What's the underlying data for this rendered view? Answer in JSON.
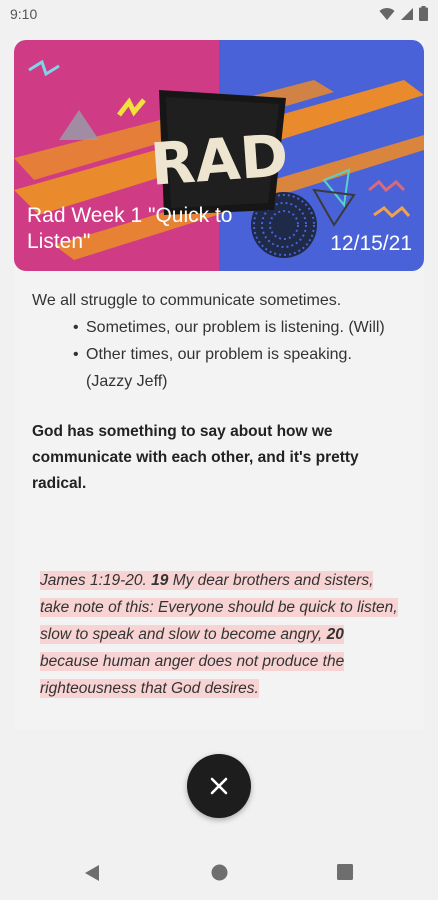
{
  "status_bar": {
    "time": "9:10"
  },
  "banner": {
    "logo_text": "RAD",
    "title": "Rad Week 1 \"Quick to Listen\"",
    "date": "12/15/21"
  },
  "content": {
    "intro": "We all struggle to communicate sometimes.",
    "bullets": [
      "Sometimes, our problem is listening. (Will)",
      "Other times, our problem is speaking. (Jazzy Jeff)"
    ],
    "bold_paragraph": "God has something to say about how we communicate with each other, and it's pretty radical.",
    "quote": {
      "reference": "James 1:19-20.",
      "verse1_num": "19",
      "verse1_text": "My dear brothers and sisters, take note of this: Everyone should be quick to listen, slow to speak and slow to become angry,",
      "verse2_num": "20",
      "verse2_text": "because human anger does not produce the righteousness that God desires."
    }
  },
  "colors": {
    "highlight": "#f7d3d3",
    "fab": "#1d1d1d",
    "banner_pink": "#cf3c85",
    "banner_blue": "#4a62d8"
  }
}
